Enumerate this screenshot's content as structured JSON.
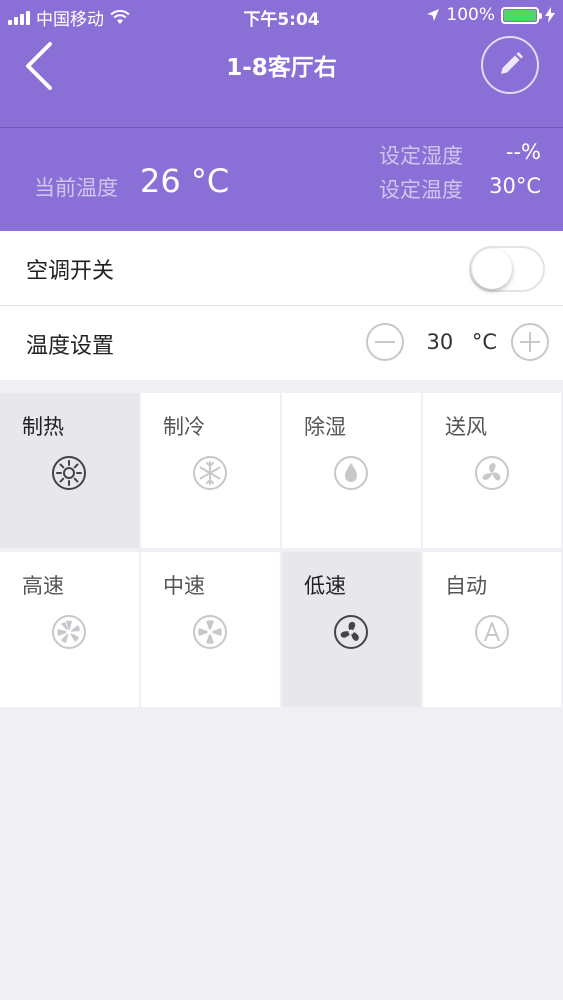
{
  "status_bar": {
    "carrier": "中国移动",
    "time": "下午5:04",
    "battery": "100%"
  },
  "nav": {
    "title": "1-8客厅右",
    "back_icon": "chevron-left-icon",
    "edit_icon": "pencil-icon"
  },
  "temps": {
    "current_label": "当前温度",
    "current_value": "26 °C",
    "set_humidity_label": "设定湿度",
    "set_humidity_value": "--%",
    "set_temp_label": "设定温度",
    "set_temp_value": "30°C"
  },
  "power": {
    "label": "空调开关",
    "on": false
  },
  "temp_setting": {
    "label": "温度设置",
    "value": "30",
    "unit": "°C"
  },
  "modes": [
    {
      "label": "制热",
      "icon": "sun-icon",
      "active": true
    },
    {
      "label": "制冷",
      "icon": "snowflake-icon",
      "active": false
    },
    {
      "label": "除湿",
      "icon": "droplet-icon",
      "active": false
    },
    {
      "label": "送风",
      "icon": "fan-swirl-icon",
      "active": false
    }
  ],
  "fan_speeds": [
    {
      "label": "高速",
      "icon": "fan-high-icon",
      "active": false
    },
    {
      "label": "中速",
      "icon": "fan-medium-icon",
      "active": false
    },
    {
      "label": "低速",
      "icon": "fan-low-icon",
      "active": true
    },
    {
      "label": "自动",
      "icon": "auto-a-icon",
      "active": false
    }
  ],
  "colors": {
    "header_bg": "#8a6fd6",
    "active_cell": "#e8e7ec",
    "battery_green": "#4cd964"
  }
}
